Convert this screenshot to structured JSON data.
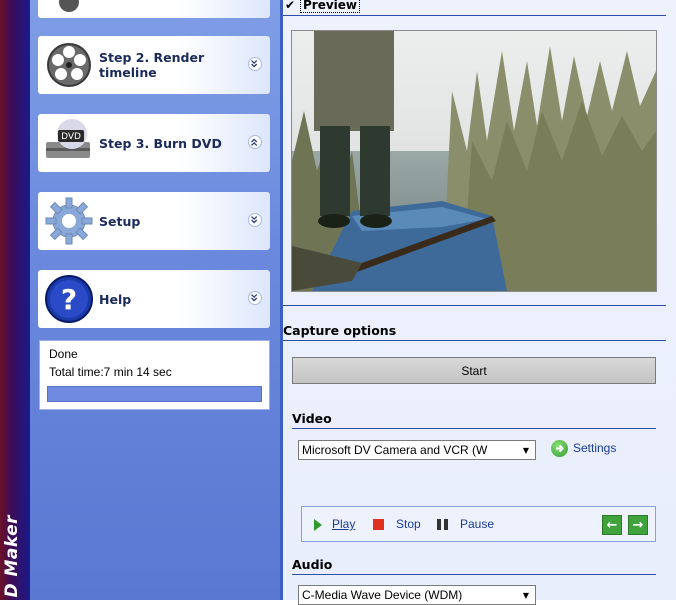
{
  "brand": {
    "text": "D Maker"
  },
  "steps": [
    {
      "label": "Step 2. Render timeline",
      "icon": "film-reel-icon",
      "chevron": "down"
    },
    {
      "label": "Step 3. Burn DVD",
      "icon": "dvd-drive-icon",
      "chevron": "up"
    },
    {
      "label": "Setup",
      "icon": "gear-icon",
      "chevron": "down"
    },
    {
      "label": "Help",
      "icon": "help-icon",
      "chevron": "down"
    }
  ],
  "status": {
    "line1": "Done",
    "line2": "Total time:7 min 14 sec",
    "progress": 1.0
  },
  "preview": {
    "checked": true,
    "label": "Preview"
  },
  "capture": {
    "title": "Capture options",
    "start_label": "Start",
    "video": {
      "title": "Video",
      "device": "Microsoft DV Camera and VCR (W",
      "settings_label": "Settings"
    },
    "transport": {
      "play": "Play",
      "stop": "Stop",
      "pause": "Pause"
    },
    "audio": {
      "title": "Audio",
      "device": "C-Media Wave Device (WDM)"
    }
  },
  "colors": {
    "panel_blue": "#6a88dc",
    "accent_green": "#3fa23a",
    "link_blue": "#1a3a9a"
  }
}
